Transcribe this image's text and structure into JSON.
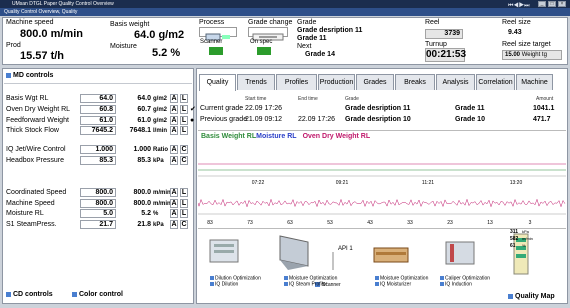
{
  "window": {
    "title": "UMsan DTGL Paper Quality Control Overview",
    "menu": "Quality Control Overview, Quality"
  },
  "top": {
    "machine_speed_label": "Machine speed",
    "machine_speed_value": "800.0 m/min",
    "prod_label": "Prod",
    "prod_value": "15.57 t/h",
    "basis_weight_label": "Basis weight",
    "basis_weight_value": "64.0 g/m2",
    "moisture_label": "Moisture",
    "moisture_value": "5.2 %",
    "process_label": "Process",
    "scanner_label": "Scanner",
    "grade_change_label": "Grade change",
    "on_spec_label": "On spec",
    "grade_label": "Grade",
    "grade_desc": "Grade desription 11",
    "grade_name": "Grade 11",
    "next_label": "Next",
    "next_grade": "Grade 14",
    "reel_label": "Reel",
    "reel_value": "3739",
    "turnup_label": "Turnup",
    "turnup_value": "00:21:53",
    "reel_size_label": "Reel size",
    "reel_size_value": "9.43",
    "reel_size_target_label": "Reel size target",
    "reel_size_target_value": "15.00",
    "reel_size_target_unit": "Weight tg"
  },
  "md": {
    "title": "MD controls",
    "rows": [
      {
        "name": "Basis Wgt RL",
        "v1": "64.0",
        "v2": "64.0",
        "unit": "g/m2",
        "a": "A",
        "b": "L",
        "extra": ""
      },
      {
        "name": "Oven Dry Weight RL",
        "v1": "60.8",
        "v2": "60.7",
        "unit": "g/m2",
        "a": "A",
        "b": "L",
        "extra": "✔"
      },
      {
        "name": "Feedforward Weight",
        "v1": "61.0",
        "v2": "61.0",
        "unit": "g/m2",
        "a": "A",
        "b": "L",
        "extra": "●"
      },
      {
        "name": "Thick Stock Flow",
        "v1": "7645.2",
        "v2": "7648.1",
        "unit": "l/min",
        "a": "A",
        "b": "L",
        "extra": ""
      },
      {
        "name": "IQ Jet/Wire Control",
        "v1": "1.000",
        "v2": "1.000",
        "unit": "Ratio",
        "a": "A",
        "b": "C",
        "extra": ""
      },
      {
        "name": "Headbox Pressure",
        "v1": "85.3",
        "v2": "85.3",
        "unit": "kPa",
        "a": "A",
        "b": "C",
        "extra": ""
      },
      {
        "name": "Coordinated Speed",
        "v1": "800.0",
        "v2": "800.0",
        "unit": "m/min",
        "a": "A",
        "b": "L",
        "extra": ""
      },
      {
        "name": "Machine Speed",
        "v1": "800.0",
        "v2": "800.0",
        "unit": "m/min",
        "a": "A",
        "b": "L",
        "extra": ""
      },
      {
        "name": "Moisture RL",
        "v1": "5.0",
        "v2": "5.2",
        "unit": "%",
        "a": "A",
        "b": "L",
        "extra": ""
      },
      {
        "name": "S1 SteamPress.",
        "v1": "21.7",
        "v2": "21.8",
        "unit": "kPa",
        "a": "A",
        "b": "C",
        "extra": ""
      }
    ],
    "cd_label": "CD controls",
    "color_label": "Color control"
  },
  "tabs": [
    "Quality",
    "Trends",
    "Profiles",
    "Production",
    "Grades",
    "Breaks",
    "Analysis",
    "Correlation",
    "Machine"
  ],
  "grades_table": {
    "headers": [
      "Start time",
      "End time",
      "Grade",
      "Amount"
    ],
    "rows": [
      {
        "label": "Current grade",
        "start": "22.09 17:26",
        "end": "",
        "desc": "Grade desription 11",
        "grade": "Grade 11",
        "amount": "1041.1"
      },
      {
        "label": "Previous grade",
        "start": "21.09 09:12",
        "end": "22.09 17:26",
        "desc": "Grade desription 10",
        "grade": "Grade 10",
        "amount": "471.7"
      }
    ]
  },
  "trend": {
    "legend": [
      {
        "name": "Basis Weight RL",
        "color": "#2e8b3a"
      },
      {
        "name": "Moisture RL",
        "color": "#2a3fc8"
      },
      {
        "name": "Oven Dry Weight RL",
        "color": "#c0186b"
      }
    ],
    "time_ticks": [
      "07:22",
      "09:21",
      "11:21",
      "13:20"
    ],
    "bottom_ticks": [
      "83",
      "73",
      "63",
      "53",
      "43",
      "33",
      "23",
      "13",
      "3"
    ]
  },
  "process": {
    "items": [
      {
        "lines": [
          "Dilution Optimization",
          "IQ Dilution"
        ]
      },
      {
        "lines": [
          "Moisture Optimization",
          "IQ Steam Profiler"
        ]
      },
      {
        "lines": [
          "Moisture Optimization",
          "IQ Moisturizer"
        ]
      },
      {
        "lines": [
          "Caliper Optimization",
          "IQ Induction"
        ]
      }
    ],
    "api_label": "API 1",
    "scanner_label": "Scanner",
    "scan_values": [
      "311",
      "582",
      "61"
    ],
    "scan_units": [
      "kPa",
      "m/min",
      "%"
    ],
    "quality_map_label": "Quality Map"
  }
}
